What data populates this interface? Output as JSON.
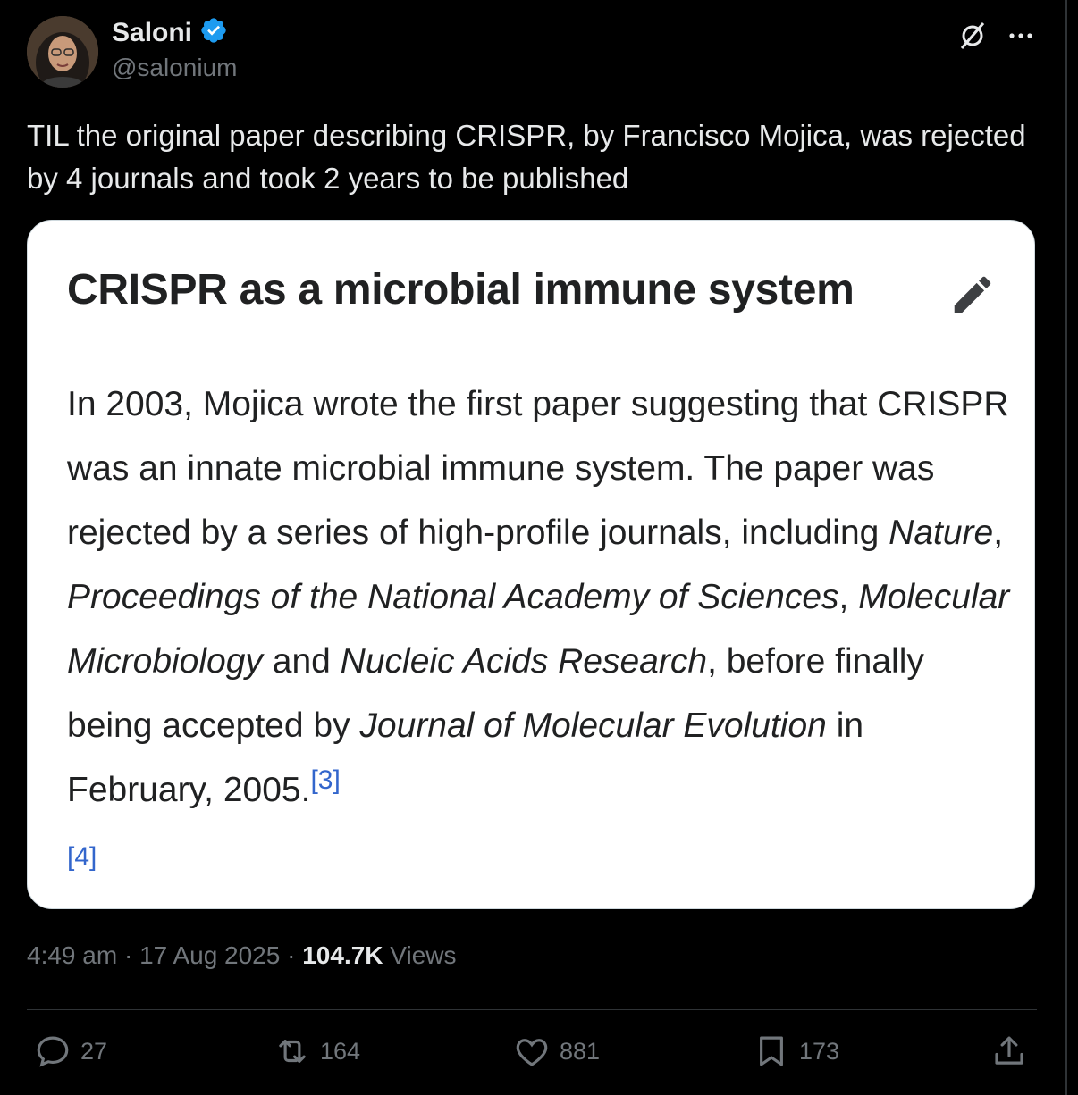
{
  "author": {
    "name": "Saloni",
    "handle": "@salonium",
    "verified": true
  },
  "tweet": {
    "text": "TIL the original paper describing CRISPR, by Francisco Mojica, was rejected by 4 journals and took 2 years to be published"
  },
  "card": {
    "title": "CRISPR as a microbial immune system",
    "body": {
      "p1": "In 2003, Mojica wrote the first paper suggesting that CRISPR was an innate microbial immune system. The paper was rejected by a series of high-profile journals, including ",
      "j1": "Nature",
      "sep1": ", ",
      "j2": "Proceedings of the National Academy of Sciences",
      "sep2": ", ",
      "j3": "Molecular Microbiology",
      "sep3": " and ",
      "j4": "Nucleic Acids Research",
      "p2": ", before finally being accepted by ",
      "j5": "Journal of Molecular Evolution",
      "p3": " in February, 2005.",
      "ref1": "[3]",
      "ref2": "[4]"
    }
  },
  "meta": {
    "time": "4:49 am",
    "dot1": " · ",
    "date": "17 Aug 2025",
    "dot2": " · ",
    "views_count": "104.7K",
    "views_label": " Views"
  },
  "actions": {
    "replies": "27",
    "reposts": "164",
    "likes": "881",
    "bookmarks": "173"
  },
  "icons": {
    "verified_color": "#1d9bf0",
    "link_color": "#3366cc"
  }
}
